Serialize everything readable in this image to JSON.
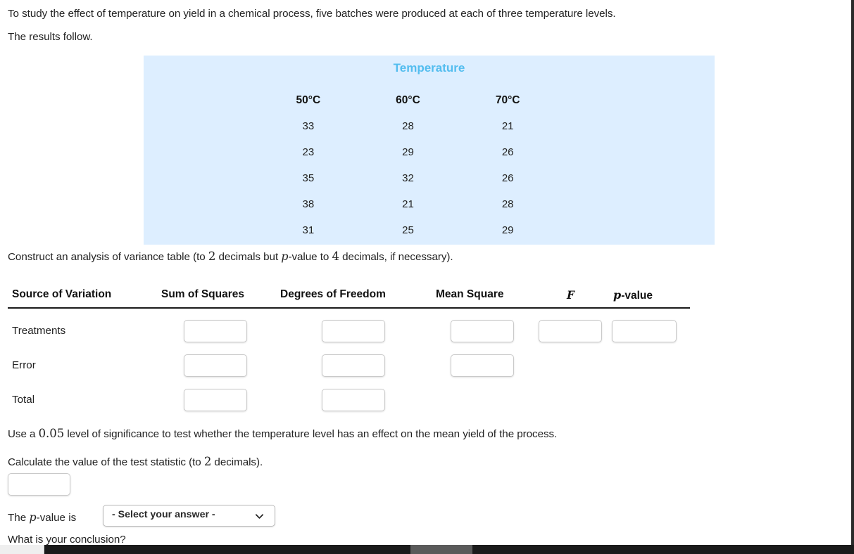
{
  "intro": {
    "line1": "To study the effect of temperature on yield in a chemical process, five batches were produced at each of three temperature levels.",
    "line2": "The results follow."
  },
  "data_panel": {
    "title": "Temperature",
    "columns": [
      "50°C",
      "60°C",
      "70°C"
    ],
    "rows": [
      [
        "33",
        "28",
        "21"
      ],
      [
        "23",
        "29",
        "26"
      ],
      [
        "35",
        "32",
        "26"
      ],
      [
        "38",
        "21",
        "28"
      ],
      [
        "31",
        "25",
        "29"
      ]
    ],
    "background_color": "#ddeeff",
    "title_color": "#53bdef"
  },
  "construct": {
    "part1": "Construct an analysis of variance table (to ",
    "decimals1": "2",
    "part2": " decimals but ",
    "pvar": "p",
    "part3": "-value to ",
    "decimals2": "4",
    "part4": " decimals, if necessary)."
  },
  "anova": {
    "headers": [
      "Source of Variation",
      "Sum of Squares",
      "Degrees of Freedom",
      "Mean Square",
      "F",
      "p-value"
    ],
    "header_f": "F",
    "header_p_italic": "p",
    "header_p_rest": "-value",
    "rows": [
      {
        "label": "Treatments",
        "inputs": [
          "",
          "",
          "",
          "",
          ""
        ]
      },
      {
        "label": "Error",
        "inputs": [
          "",
          "",
          ""
        ]
      },
      {
        "label": "Total",
        "inputs": [
          "",
          ""
        ]
      }
    ]
  },
  "significance": {
    "part1": "Use a ",
    "alpha": "0.05",
    "part2": " level of significance to test whether the temperature level has an effect on the mean yield of the process."
  },
  "calculate": {
    "part1": "Calculate the value of the test statistic (to ",
    "decimals": "2",
    "part2": " decimals)."
  },
  "test_statistic": {
    "value": "",
    "placeholder": ""
  },
  "pvalue": {
    "label_pre": "The ",
    "label_var": "p",
    "label_post": "-value is",
    "selected": "- Select your answer -",
    "options": [
      "- Select your answer -"
    ]
  },
  "conclusion": {
    "question": "What is your conclusion?"
  },
  "scrollbar": {
    "orientation": "horizontal"
  }
}
